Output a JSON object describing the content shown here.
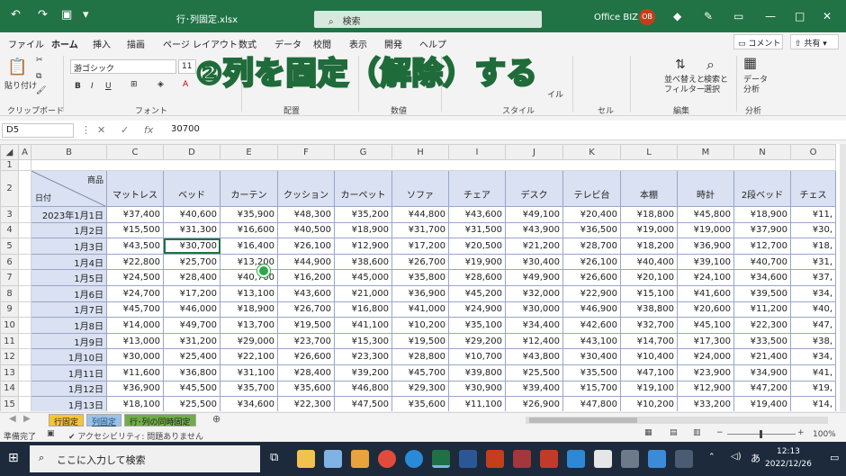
{
  "title_bar": {
    "autosave_icon": "undo-icon",
    "filename": "行･列固定.xlsx",
    "search_placeholder": "検索",
    "account": "Office BIZ",
    "avatar": "OB"
  },
  "tabs": [
    "ファイル",
    "ホーム",
    "挿入",
    "描画",
    "ページ レイアウト",
    "数式",
    "データ",
    "校閲",
    "表示",
    "開発",
    "ヘルプ"
  ],
  "comment_label": "コメント",
  "share_label": "共有",
  "ribbon": {
    "groups": [
      "クリップボード",
      "フォント",
      "配置",
      "数値",
      "スタイル",
      "セル",
      "編集",
      "分析"
    ],
    "paste": "貼り付け",
    "font_name": "游ゴシック",
    "font_size": "11",
    "sort": "並べ替えと\nフィルター",
    "find": "検索と\n選択",
    "data_analysis": "データ\n分析",
    "cells_fragment": "イル"
  },
  "overlay_text": "②列を固定（解除）する",
  "formula_bar": {
    "name_box": "D5",
    "value": "30700",
    "fx": "fx"
  },
  "columns": [
    "A",
    "B",
    "C",
    "D",
    "E",
    "F",
    "G",
    "H",
    "I",
    "J",
    "K",
    "L",
    "M",
    "N",
    "O"
  ],
  "header_row": {
    "corner_top": "商品",
    "corner_bottom": "日付",
    "items": [
      "マットレス",
      "ベッド",
      "カーテン",
      "クッション",
      "カーペット",
      "ソファ",
      "チェア",
      "デスク",
      "テレビ台",
      "本棚",
      "時計",
      "2段ベッド",
      "チェス"
    ]
  },
  "rows": [
    {
      "n": "3",
      "date": "2023年1月1日",
      "vals": [
        "¥37,400",
        "¥40,600",
        "¥35,900",
        "¥48,300",
        "¥35,200",
        "¥44,800",
        "¥43,600",
        "¥49,100",
        "¥20,400",
        "¥18,800",
        "¥45,800",
        "¥18,900",
        "¥11,"
      ]
    },
    {
      "n": "4",
      "date": "1月2日",
      "vals": [
        "¥15,500",
        "¥31,300",
        "¥16,600",
        "¥40,500",
        "¥18,900",
        "¥31,700",
        "¥31,500",
        "¥43,900",
        "¥36,500",
        "¥19,000",
        "¥19,000",
        "¥37,900",
        "¥30,"
      ]
    },
    {
      "n": "5",
      "date": "1月3日",
      "vals": [
        "¥43,500",
        "¥30,700",
        "¥16,400",
        "¥26,100",
        "¥12,900",
        "¥17,200",
        "¥20,500",
        "¥21,200",
        "¥28,700",
        "¥18,200",
        "¥36,900",
        "¥12,700",
        "¥18,"
      ]
    },
    {
      "n": "6",
      "date": "1月4日",
      "vals": [
        "¥22,800",
        "¥25,700",
        "¥13,200",
        "¥44,900",
        "¥38,600",
        "¥26,700",
        "¥19,900",
        "¥30,400",
        "¥26,100",
        "¥40,400",
        "¥39,100",
        "¥40,700",
        "¥31,"
      ]
    },
    {
      "n": "7",
      "date": "1月5日",
      "vals": [
        "¥24,500",
        "¥28,400",
        "¥40,700",
        "¥16,200",
        "¥45,000",
        "¥35,800",
        "¥28,600",
        "¥49,900",
        "¥26,600",
        "¥20,100",
        "¥24,100",
        "¥34,600",
        "¥37,"
      ]
    },
    {
      "n": "8",
      "date": "1月6日",
      "vals": [
        "¥24,700",
        "¥17,200",
        "¥13,100",
        "¥43,600",
        "¥21,000",
        "¥36,900",
        "¥45,200",
        "¥32,000",
        "¥22,900",
        "¥15,100",
        "¥41,600",
        "¥39,500",
        "¥34,"
      ]
    },
    {
      "n": "9",
      "date": "1月7日",
      "vals": [
        "¥45,700",
        "¥46,000",
        "¥18,900",
        "¥26,700",
        "¥16,800",
        "¥41,000",
        "¥24,900",
        "¥30,000",
        "¥46,900",
        "¥38,800",
        "¥20,600",
        "¥11,200",
        "¥40,"
      ]
    },
    {
      "n": "10",
      "date": "1月8日",
      "vals": [
        "¥14,000",
        "¥49,700",
        "¥13,700",
        "¥19,500",
        "¥41,100",
        "¥10,200",
        "¥35,100",
        "¥34,400",
        "¥42,600",
        "¥32,700",
        "¥45,100",
        "¥22,300",
        "¥47,"
      ]
    },
    {
      "n": "11",
      "date": "1月9日",
      "vals": [
        "¥13,000",
        "¥31,200",
        "¥29,000",
        "¥23,700",
        "¥15,300",
        "¥19,500",
        "¥29,200",
        "¥12,400",
        "¥43,100",
        "¥14,700",
        "¥17,300",
        "¥33,500",
        "¥38,"
      ]
    },
    {
      "n": "12",
      "date": "1月10日",
      "vals": [
        "¥30,000",
        "¥25,400",
        "¥22,100",
        "¥26,600",
        "¥23,300",
        "¥28,800",
        "¥10,700",
        "¥43,800",
        "¥30,400",
        "¥10,400",
        "¥24,000",
        "¥21,400",
        "¥34,"
      ]
    },
    {
      "n": "13",
      "date": "1月11日",
      "vals": [
        "¥11,600",
        "¥36,800",
        "¥31,100",
        "¥28,400",
        "¥39,200",
        "¥45,700",
        "¥39,800",
        "¥25,500",
        "¥35,500",
        "¥47,100",
        "¥23,900",
        "¥34,900",
        "¥41,"
      ]
    },
    {
      "n": "14",
      "date": "1月12日",
      "vals": [
        "¥36,900",
        "¥45,500",
        "¥35,700",
        "¥35,600",
        "¥46,800",
        "¥29,300",
        "¥30,900",
        "¥39,400",
        "¥15,700",
        "¥19,100",
        "¥12,900",
        "¥47,200",
        "¥19,"
      ]
    },
    {
      "n": "15",
      "date": "1月13日",
      "vals": [
        "¥18,100",
        "¥25,500",
        "¥34,600",
        "¥22,300",
        "¥47,500",
        "¥35,600",
        "¥11,100",
        "¥26,900",
        "¥47,800",
        "¥10,200",
        "¥33,200",
        "¥19,400",
        "¥14,"
      ]
    }
  ],
  "sheet_tabs": [
    "行固定",
    "列固定",
    "行･列の同時固定"
  ],
  "status": {
    "ready": "準備完了",
    "accessibility": "アクセシビリティ: 問題ありません",
    "zoom": "100%"
  },
  "taskbar": {
    "search_placeholder": "ここに入力して検索",
    "time": "12:13",
    "date": "2022/12/26",
    "ime": "あ"
  }
}
